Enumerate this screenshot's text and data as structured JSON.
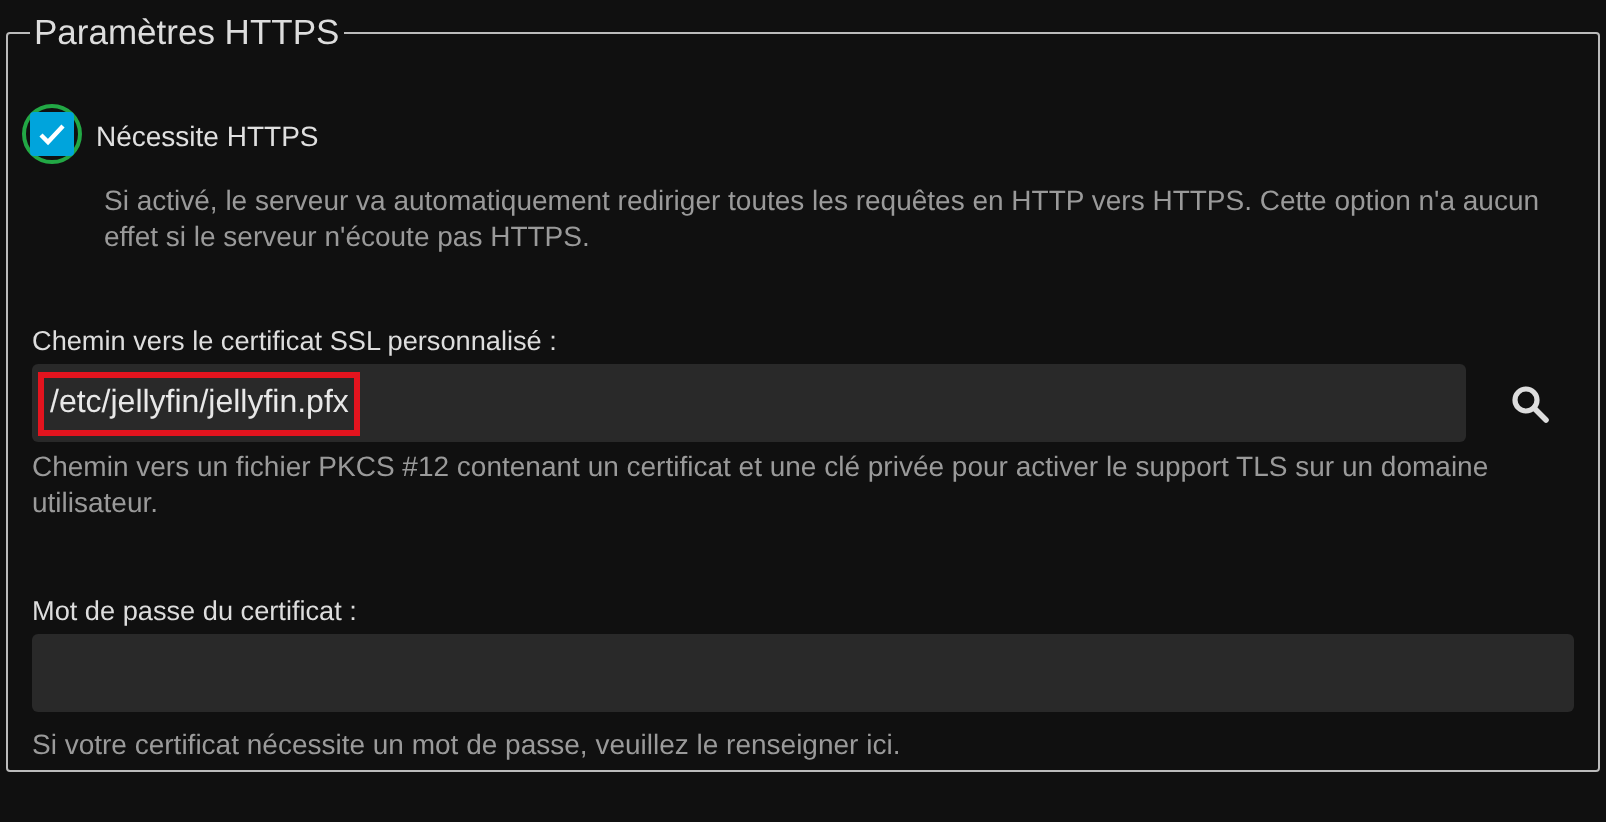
{
  "section": {
    "title": "Paramètres HTTPS"
  },
  "require_https": {
    "label": "Nécessite HTTPS",
    "checked": true,
    "circled": true,
    "description": "Si activé, le serveur va automatiquement rediriger toutes les requêtes en HTTP vers HTTPS. Cette option n'a aucun effet si le serveur n'écoute pas HTTPS."
  },
  "certificate_path": {
    "label": "Chemin vers le certificat SSL personnalisé :",
    "value": "/etc/jellyfin/jellyfin.pfx",
    "highlighted": true,
    "help": "Chemin vers un fichier PKCS #12 contenant un certificat et une clé privée pour activer le support TLS sur un domaine utilisateur."
  },
  "certificate_password": {
    "label": "Mot de passe du certificat :",
    "help": "Si votre certificat nécessite un mot de passe, veuillez le renseigner ici."
  }
}
